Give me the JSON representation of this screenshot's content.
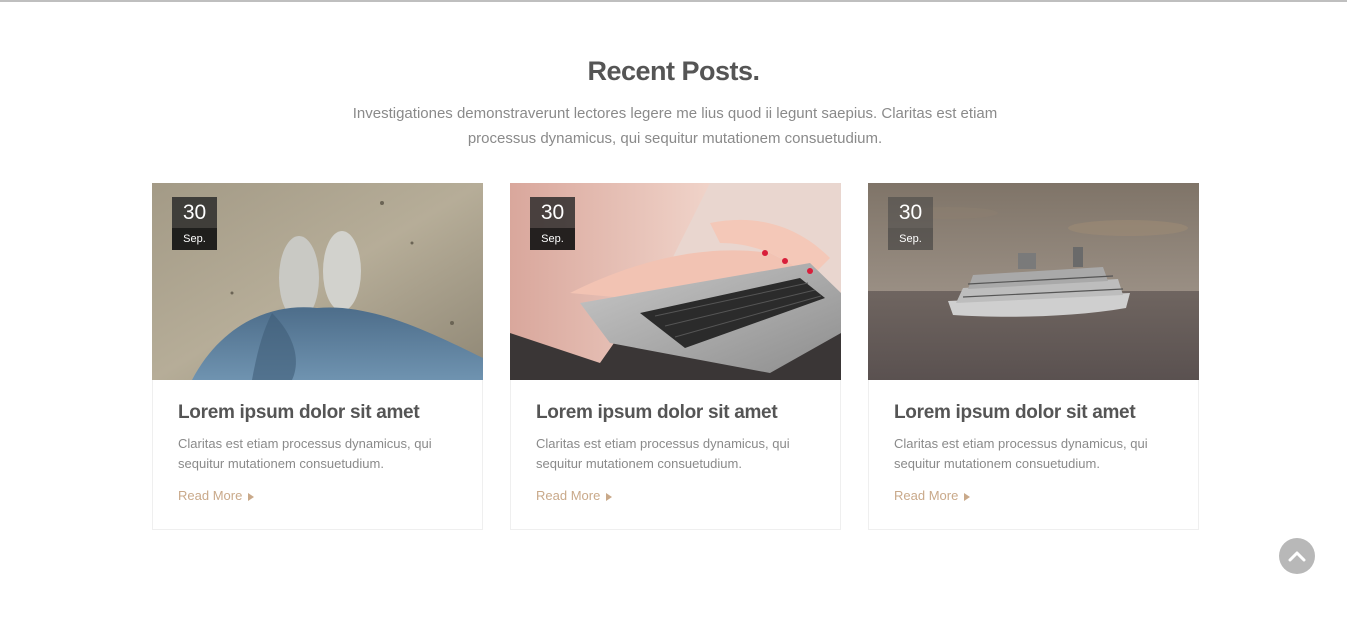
{
  "section": {
    "title": "Recent Posts.",
    "subtitle": "Investigationes demonstraverunt lectores legere me lius quod ii legunt saepius. Claritas est etiam processus dynamicus, qui sequitur mutationem consuetudium."
  },
  "posts": [
    {
      "day": "30",
      "month": "Sep.",
      "title": "Lorem ipsum dolor sit amet",
      "excerpt": "Claritas est etiam processus dynamicus, qui sequitur mutationem consuetudium.",
      "read_more": "Read More",
      "image": "sneakers-on-sand"
    },
    {
      "day": "30",
      "month": "Sep.",
      "title": "Lorem ipsum dolor sit amet",
      "excerpt": "Claritas est etiam processus dynamicus, qui sequitur mutationem consuetudium.",
      "read_more": "Read More",
      "image": "hands-typing-on-laptop"
    },
    {
      "day": "30",
      "month": "Sep.",
      "title": "Lorem ipsum dolor sit amet",
      "excerpt": "Claritas est etiam processus dynamicus, qui sequitur mutationem consuetudium.",
      "read_more": "Read More",
      "image": "cruise-ship-at-sea"
    }
  ],
  "scroll_top": {
    "icon": "chevron-up-icon"
  },
  "colors": {
    "accent": "#c9a98a",
    "heading": "#555555",
    "body_text": "#8a8a8a",
    "scroll_button": "#b8b8b8"
  }
}
